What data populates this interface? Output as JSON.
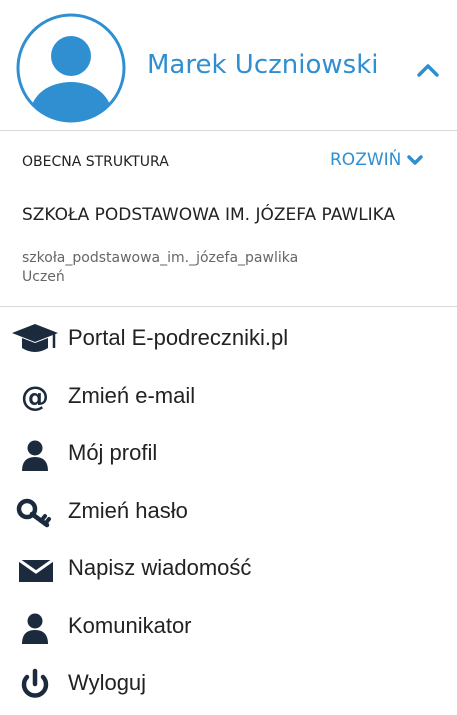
{
  "user": {
    "name": "Marek Uczniowski"
  },
  "structure": {
    "label": "OBECNA STRUKTURA",
    "expand_label": "ROZWIŃ",
    "school_name": "SZKOŁA PODSTAWOWA IM. JÓZEFA PAWLIKA",
    "school_slug": "szkoła_podstawowa_im._józefa_pawlika",
    "role": "Uczeń"
  },
  "colors": {
    "accent": "#2f8fd1",
    "text": "#222222",
    "muted": "#666666",
    "divider": "#d8d8d8"
  },
  "menu": [
    {
      "label": "Portal E-podreczniki.pl",
      "icon": "graduation-cap-icon"
    },
    {
      "label": "Zmień e-mail",
      "icon": "at-sign-icon"
    },
    {
      "label": "Mój profil",
      "icon": "user-icon"
    },
    {
      "label": "Zmień hasło",
      "icon": "key-icon"
    },
    {
      "label": "Napisz wiadomość",
      "icon": "envelope-icon"
    },
    {
      "label": "Komunikator",
      "icon": "user-icon"
    },
    {
      "label": "Wyloguj",
      "icon": "power-icon"
    }
  ]
}
